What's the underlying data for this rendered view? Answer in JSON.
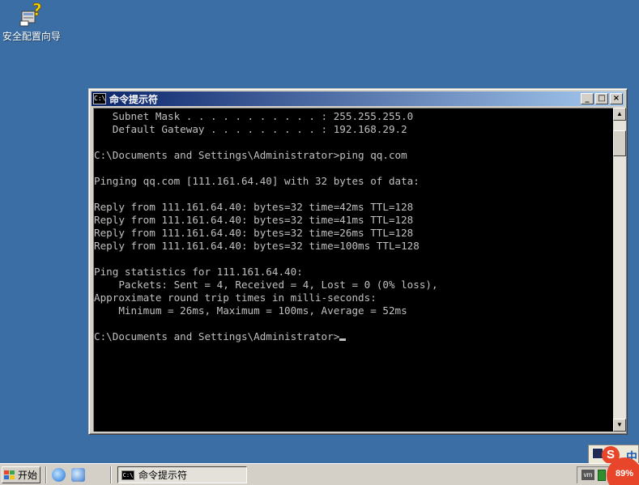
{
  "desktop": {
    "icons": [
      {
        "label": "安全配置向导",
        "icon": "security-wizard-icon"
      }
    ]
  },
  "window": {
    "title": "命令提示符",
    "icon_text": "C:\\",
    "buttons": {
      "minimize": "_",
      "maximize": "□",
      "close": "×"
    }
  },
  "console": {
    "lines": [
      "   Subnet Mask . . . . . . . . . . . : 255.255.255.0",
      "   Default Gateway . . . . . . . . . : 192.168.29.2",
      "",
      "C:\\Documents and Settings\\Administrator>ping qq.com",
      "",
      "Pinging qq.com [111.161.64.40] with 32 bytes of data:",
      "",
      "Reply from 111.161.64.40: bytes=32 time=42ms TTL=128",
      "Reply from 111.161.64.40: bytes=32 time=41ms TTL=128",
      "Reply from 111.161.64.40: bytes=32 time=26ms TTL=128",
      "Reply from 111.161.64.40: bytes=32 time=100ms TTL=128",
      "",
      "Ping statistics for 111.161.64.40:",
      "    Packets: Sent = 4, Received = 4, Lost = 0 (0% loss),",
      "Approximate round trip times in milli-seconds:",
      "    Minimum = 26ms, Maximum = 100ms, Average = 52ms",
      ""
    ],
    "prompt": "C:\\Documents and Settings\\Administrator>"
  },
  "scrollbar": {
    "up_arrow": "▲",
    "down_arrow": "▼"
  },
  "ime": {
    "logo": "S",
    "mode": "中"
  },
  "taskbar": {
    "start_label": "开始",
    "tasks": [
      {
        "label": "命令提示符",
        "icon_text": "C:\\"
      }
    ],
    "tray": {
      "vm_label": "vm",
      "gauge_label": "89%"
    }
  },
  "colors": {
    "desktop": "#3a6ea5",
    "console_bg": "#000000",
    "console_fg": "#c0c0c0",
    "titlebar_start": "#0a246a",
    "titlebar_end": "#a6caf0"
  }
}
